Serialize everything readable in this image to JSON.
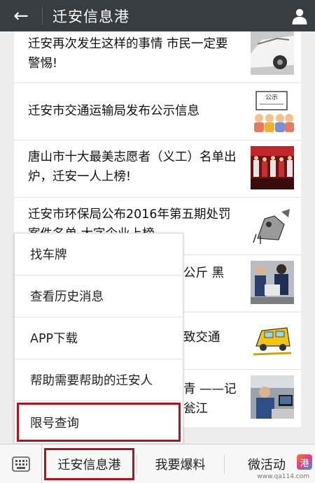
{
  "header": {
    "back_icon": "←",
    "title": "迁安信息港",
    "profile_icon": "person-icon"
  },
  "articles": [
    {
      "title": "迁安再次发生这样的事情 市民一定要警惕!"
    },
    {
      "title": "迁安市交通运输局发布公示信息",
      "thumb_label": "公示"
    },
    {
      "title": "唐山市十大最美志愿者（义工）名单出炉，迁安一人上榜!"
    },
    {
      "title": "迁安市环保局公布2016年第五期处罚案件名单 大字企业上榜"
    },
    {
      "title": "公斤 黑"
    },
    {
      "title": "致交通"
    },
    {
      "title": "青 ——记 瓮江"
    }
  ],
  "menu": {
    "items": [
      "找车牌",
      "查看历史消息",
      "APP下载",
      "帮助需要帮助的迁安人",
      "限号查询"
    ]
  },
  "bottom_bar": {
    "tabs": [
      "迁安信息港",
      "我要爆料",
      "微活动"
    ],
    "logo_text": "港",
    "watermark": "www.qa114.com"
  },
  "colors": {
    "header_bg": "#383d42",
    "highlight": "#b3121d"
  }
}
